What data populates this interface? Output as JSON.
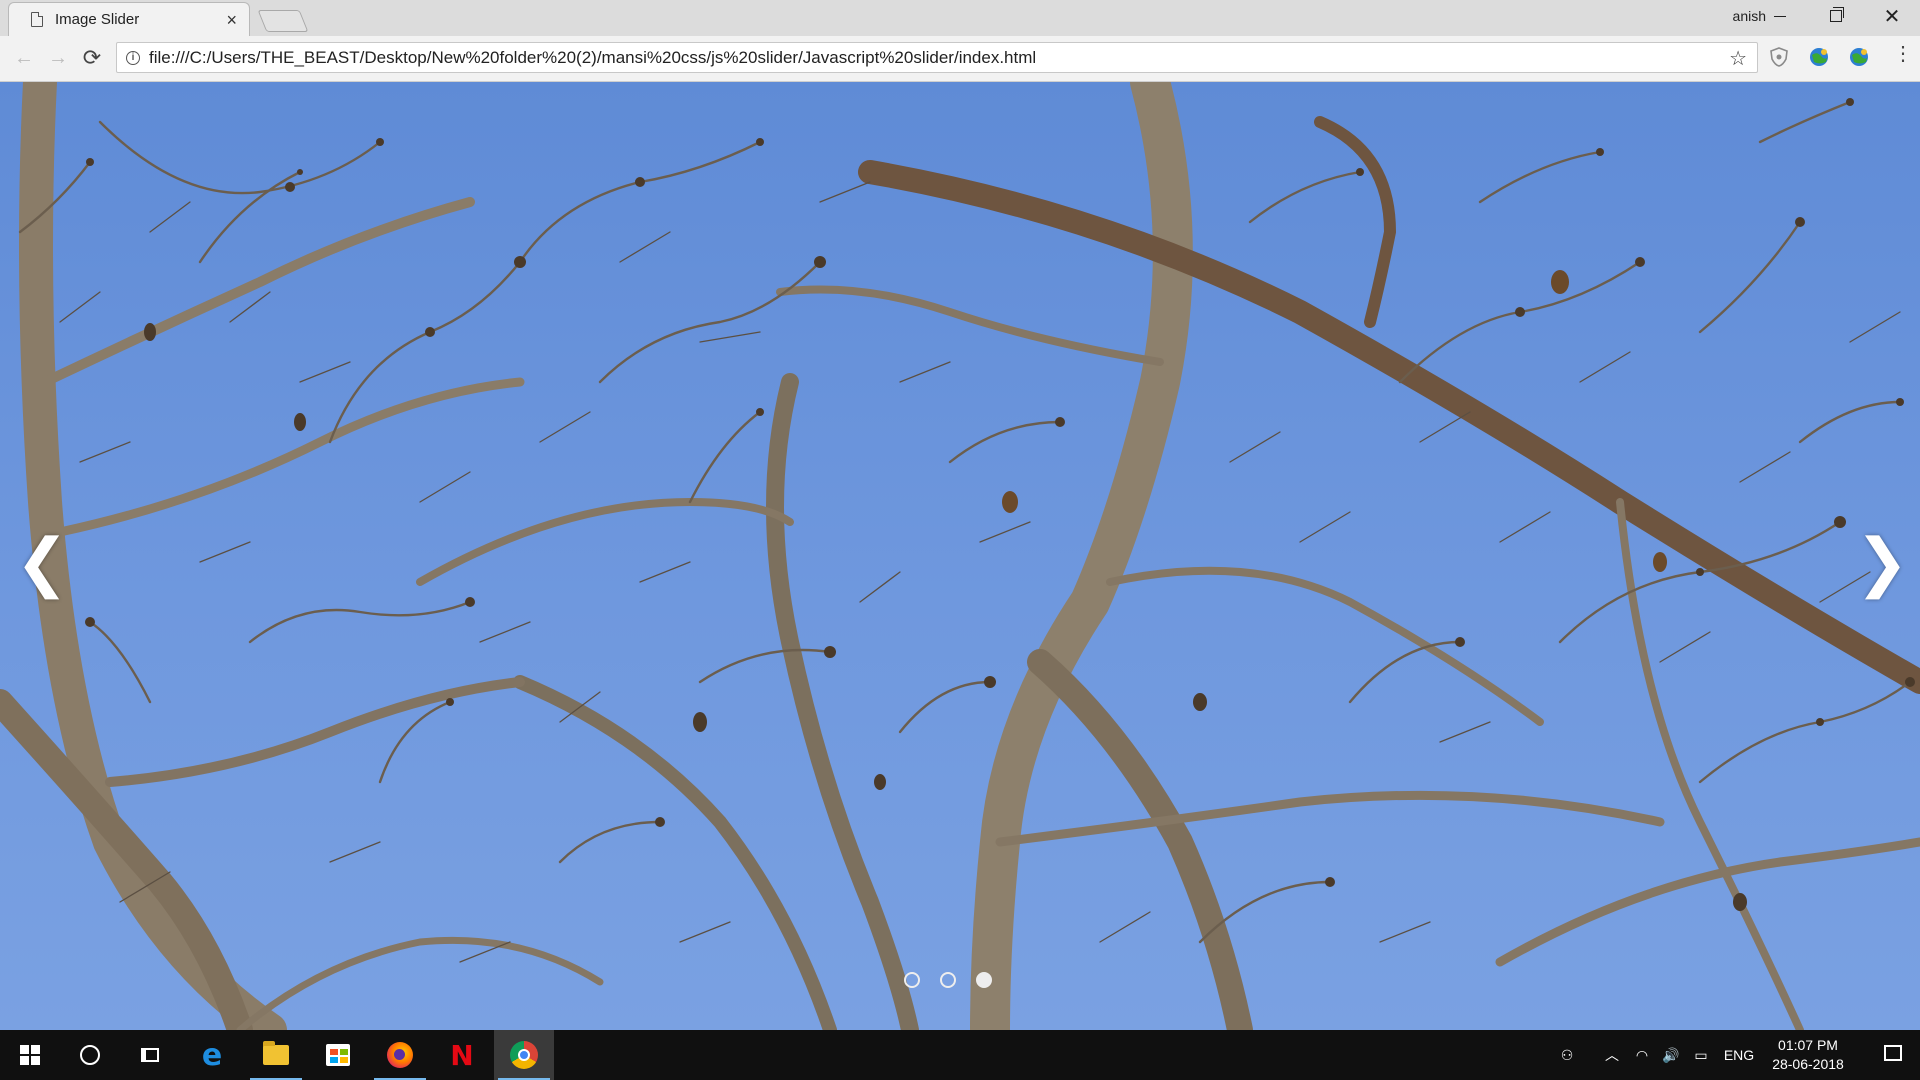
{
  "browser": {
    "tab": {
      "title": "Image Slider",
      "close_glyph": "×"
    },
    "profile_name": "anish",
    "window_controls": {
      "close_glyph": "✕"
    },
    "toolbar": {
      "back_glyph": "←",
      "forward_glyph": "→",
      "reload_glyph": "⟳",
      "info_glyph": "i",
      "url": "file:///C:/Users/THE_BEAST/Desktop/New%20folder%20(2)/mansi%20css/js%20slider/Javascript%20slider/index.html",
      "bookmark_glyph": "☆",
      "menu_glyph": "⋮"
    }
  },
  "slider": {
    "prev_glyph": "❮",
    "next_glyph": "❯",
    "dots": [
      {
        "active": false
      },
      {
        "active": false
      },
      {
        "active": true
      }
    ],
    "sky_color": "#6a94dc"
  },
  "taskbar": {
    "apps": [
      "start-icon",
      "cortana-icon",
      "task-view-icon",
      "edge-icon",
      "file-explorer-icon",
      "store-icon",
      "firefox-icon",
      "netflix-icon",
      "chrome-icon"
    ],
    "netflix_glyph": "N",
    "edge_glyph": "e",
    "tray": {
      "people_glyph": "⚇",
      "chevron_glyph": "︿",
      "wifi_glyph": "◠",
      "volume_glyph": "🔊",
      "battery_glyph": "▭",
      "language": "ENG"
    },
    "clock": {
      "time": "01:07 PM",
      "date": "28-06-2018"
    }
  }
}
